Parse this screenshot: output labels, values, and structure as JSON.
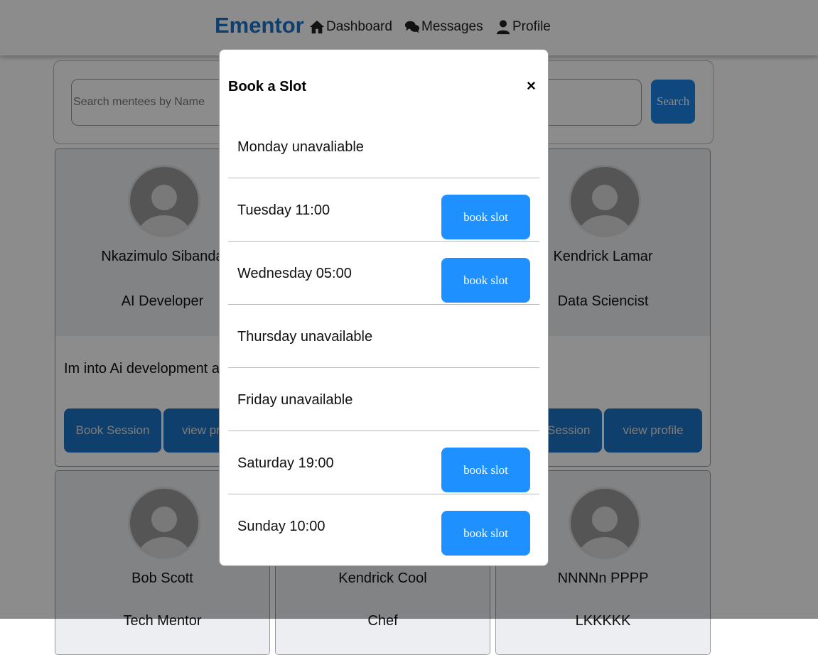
{
  "header": {
    "brand": "Ementor",
    "nav": [
      {
        "label": "Dashboard",
        "icon": "home-icon"
      },
      {
        "label": "Messages",
        "icon": "chat-bubbles-icon"
      },
      {
        "label": "Profile",
        "icon": "user-icon"
      }
    ]
  },
  "search": {
    "placeholder": "Search mentees by Name",
    "button_label": "Search"
  },
  "cards": [
    {
      "name": "Nkazimulo Sibanda",
      "role": "AI Developer",
      "bio": "Im into Ai development and",
      "book_label": "Book Session",
      "view_label": "view profile"
    },
    {
      "name": "Kendrick Lamar",
      "role": "Data Sciencist",
      "bio": ".",
      "book_label": "Book Session",
      "view_label": "view profile"
    },
    {
      "name": "Bob Scott",
      "role": "Tech Mentor"
    },
    {
      "name": "Kendrick Cool",
      "role": "Chef"
    },
    {
      "name": "NNNNn PPPP",
      "role": "LKKKKK"
    }
  ],
  "modal": {
    "title": "Book a Slot",
    "close_label": "×",
    "slots": [
      {
        "label": "Monday unavaliable",
        "button": null
      },
      {
        "label": "Tuesday 11:00",
        "button": "book slot"
      },
      {
        "label": "Wednesday 05:00",
        "button": "book slot"
      },
      {
        "label": "Thursday unavailable",
        "button": null
      },
      {
        "label": "Friday unavailable",
        "button": null
      },
      {
        "label": "Saturday 19:00",
        "button": "book slot"
      },
      {
        "label": "Sunday 10:00",
        "button": "book slot"
      }
    ]
  },
  "colors": {
    "brand": "#1a73c7",
    "primary_button": "#1a73c7",
    "slot_button": "#1e90ff",
    "overlay": "rgba(0,0,0,0.45)"
  }
}
